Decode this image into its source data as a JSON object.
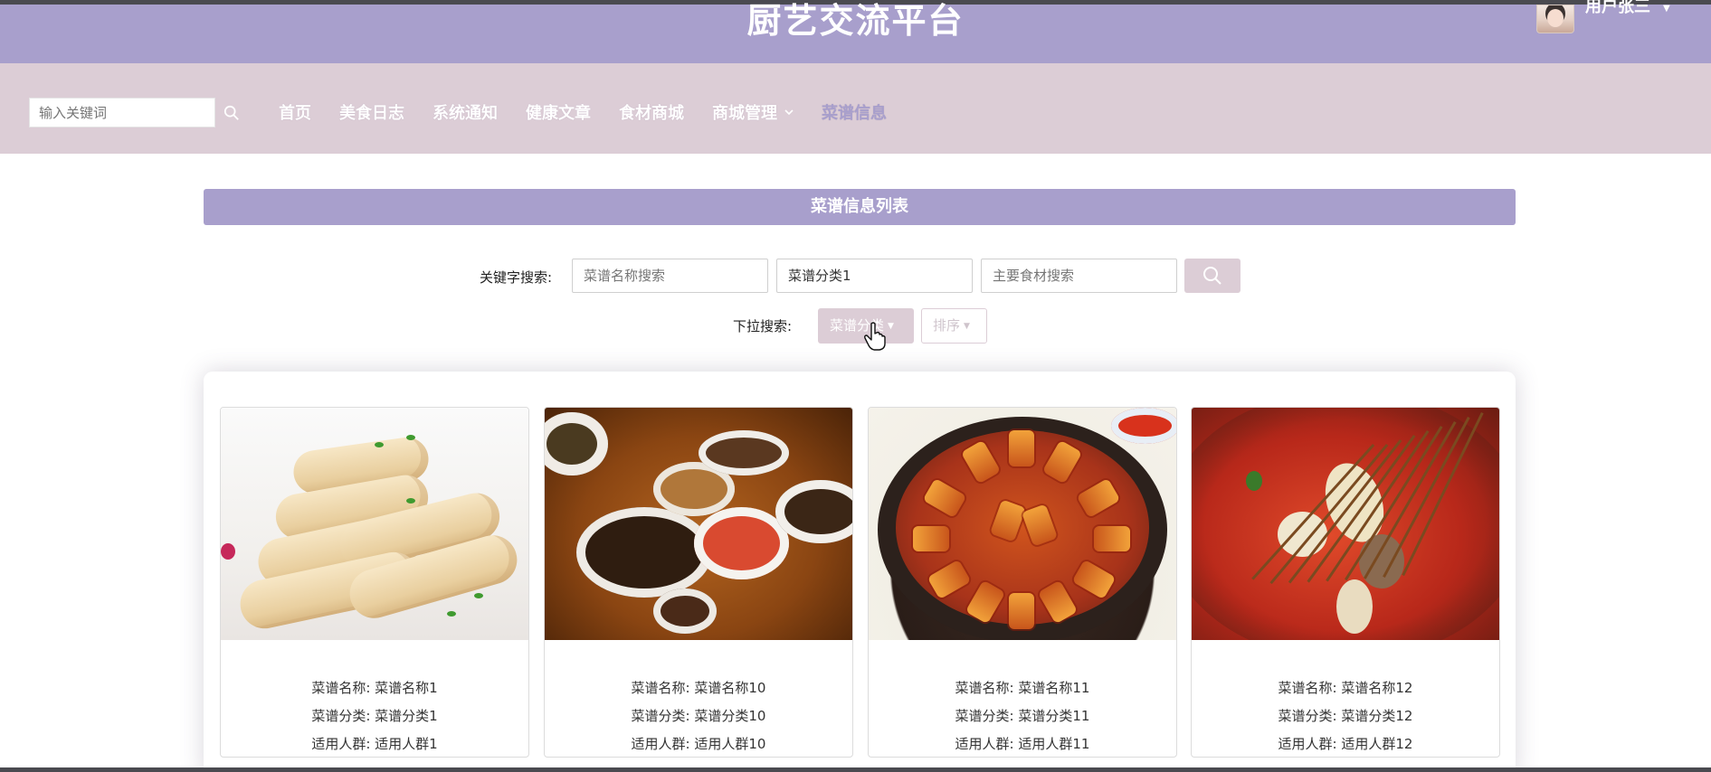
{
  "header": {
    "site_title": "厨艺交流平台",
    "user_name": "用户张三",
    "user_caret": "▼"
  },
  "nav": {
    "search_placeholder": "输入关键词",
    "items": [
      {
        "label": "首页"
      },
      {
        "label": "美食日志"
      },
      {
        "label": "系统通知"
      },
      {
        "label": "健康文章"
      },
      {
        "label": "食材商城"
      },
      {
        "label": "商城管理"
      },
      {
        "label": "菜谱信息"
      }
    ]
  },
  "list": {
    "title": "菜谱信息列表",
    "keyword_label": "关键字搜索:",
    "name_placeholder": "菜谱名称搜索",
    "category_value": "菜谱分类1",
    "ingredient_placeholder": "主要食材搜索",
    "dropdown_label": "下拉搜索:",
    "category_dropdown": "菜谱分类",
    "sort_dropdown": "排序",
    "dropdown_caret": "▼"
  },
  "cards": [
    {
      "name_line": "菜谱名称: 菜谱名称1",
      "category_line": "菜谱分类: 菜谱分类1",
      "audience_line": "适用人群: 适用人群1"
    },
    {
      "name_line": "菜谱名称: 菜谱名称10",
      "category_line": "菜谱分类: 菜谱分类10",
      "audience_line": "适用人群: 适用人群10"
    },
    {
      "name_line": "菜谱名称: 菜谱名称11",
      "category_line": "菜谱分类: 菜谱分类11",
      "audience_line": "适用人群: 适用人群11"
    },
    {
      "name_line": "菜谱名称: 菜谱名称12",
      "category_line": "菜谱分类: 菜谱分类12",
      "audience_line": "适用人群: 适用人群12"
    }
  ],
  "theme": {
    "header_bg": "#a89fcc",
    "nav_bg": "#dccdd6",
    "active_nav": "#a89fcc"
  }
}
